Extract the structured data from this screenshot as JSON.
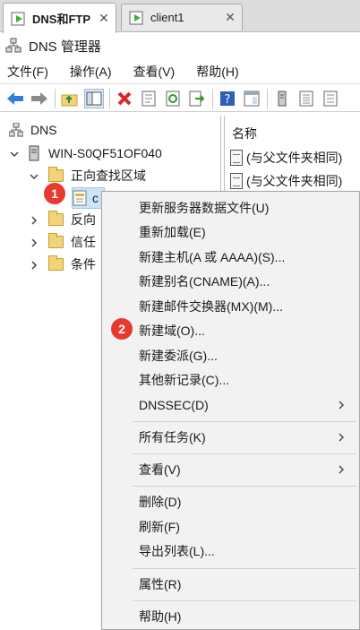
{
  "tabs": [
    {
      "label": "DNS和FTP",
      "close": "✕"
    },
    {
      "label": "client1",
      "close": "✕"
    }
  ],
  "window_title": "DNS 管理器",
  "menu": [
    "文件(F)",
    "操作(A)",
    "查看(V)",
    "帮助(H)"
  ],
  "toolbar_icons": [
    "back-icon",
    "forward-icon",
    "up-folder-icon",
    "show-hide-tree-icon",
    "delete-icon",
    "properties-icon",
    "refresh-icon",
    "export-list-icon",
    "help-icon",
    "console-view-icon",
    "server-icon",
    "records-icon",
    "zone-icon"
  ],
  "tree": {
    "root": "DNS",
    "server": "WIN-S0QF51OF040",
    "forward_zone": "正向查找区域",
    "zone_child": "c",
    "reverse_zone": "反向",
    "trust": "信任",
    "conditional": "条件"
  },
  "list": {
    "header": "名称",
    "rows": [
      "(与父文件夹相同)",
      "(与父文件夹相同)"
    ]
  },
  "context_menu": {
    "items": [
      {
        "label": "更新服务器数据文件(U)"
      },
      {
        "label": "重新加载(E)"
      },
      {
        "label": "新建主机(A 或 AAAA)(S)..."
      },
      {
        "label": "新建别名(CNAME)(A)..."
      },
      {
        "label": "新建邮件交换器(MX)(M)..."
      },
      {
        "label": "新建域(O)..."
      },
      {
        "label": "新建委派(G)..."
      },
      {
        "label": "其他新记录(C)..."
      },
      {
        "label": "DNSSEC(D)"
      },
      {
        "label": "所有任务(K)"
      },
      {
        "label": "查看(V)"
      },
      {
        "label": "删除(D)"
      },
      {
        "label": "刷新(F)"
      },
      {
        "label": "导出列表(L)..."
      },
      {
        "label": "属性(R)"
      },
      {
        "label": "帮助(H)"
      }
    ]
  },
  "annotations": [
    "1",
    "2"
  ],
  "colors": {
    "accent_red": "#e8392f",
    "menu_bg": "#f2f2f2",
    "folder": "#f2d37b"
  }
}
